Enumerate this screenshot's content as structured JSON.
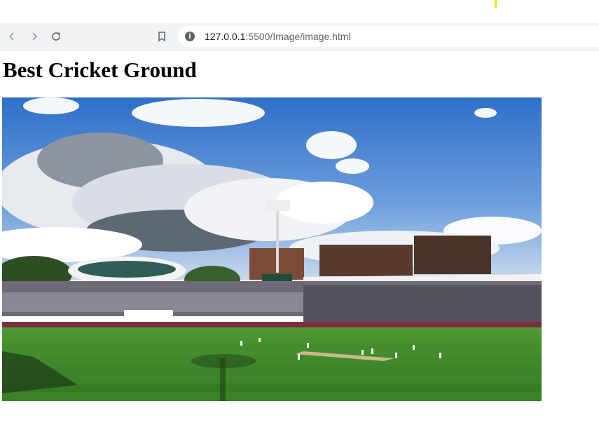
{
  "browser": {
    "url_host": "127.0.0.1",
    "url_path": ":5500/Image/image.html"
  },
  "page": {
    "heading": "Best Cricket Ground"
  },
  "image": {
    "subject": "cricket-stadium-photo"
  },
  "colors": {
    "sky": "#3a78c9",
    "grass": "#3f8a2c",
    "toolbar": "#f1f3f4"
  }
}
